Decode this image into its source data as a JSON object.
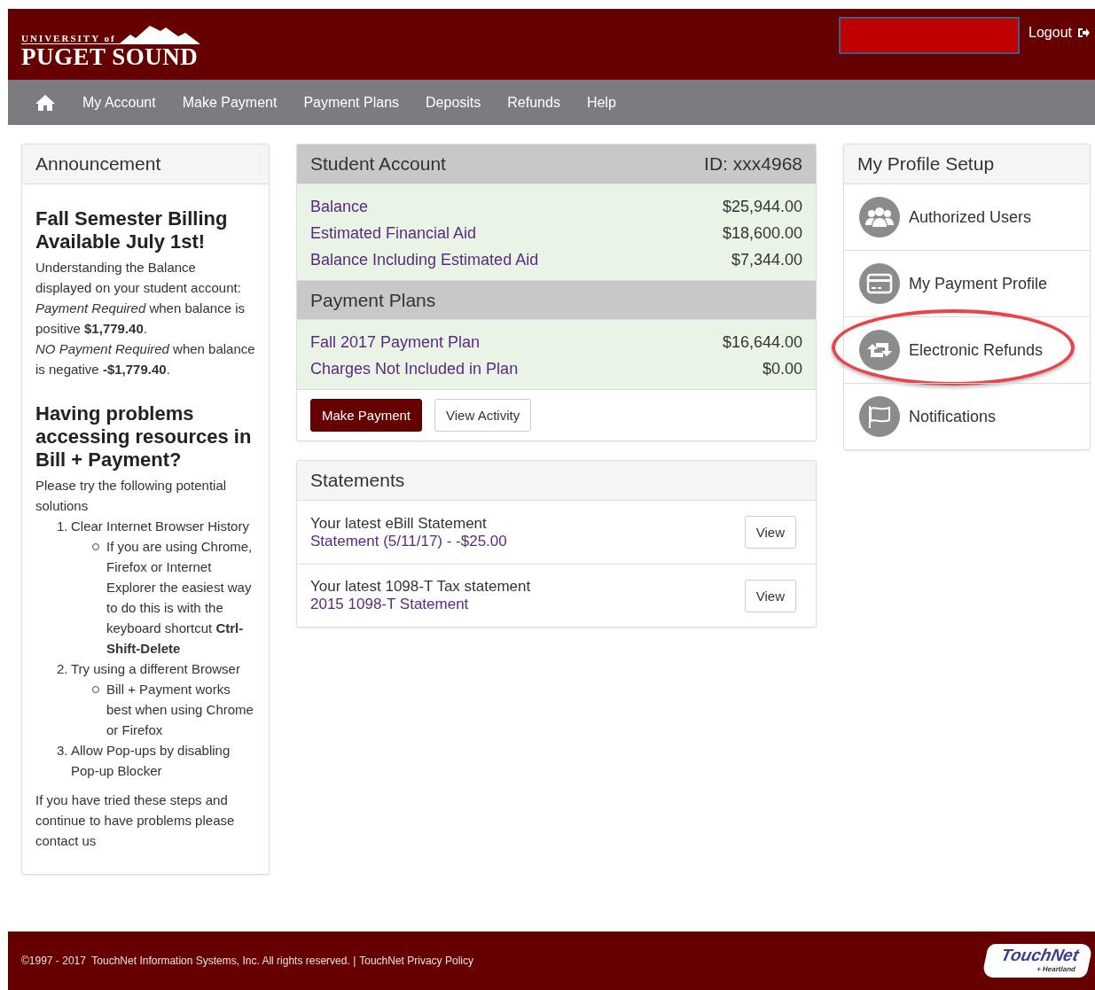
{
  "header": {
    "logo_top": "UNIVERSITY of",
    "logo_main": "PUGET SOUND",
    "logout": "Logout"
  },
  "nav": {
    "items": [
      "My Account",
      "Make Payment",
      "Payment Plans",
      "Deposits",
      "Refunds",
      "Help"
    ]
  },
  "announcement": {
    "title": "Announcement",
    "blocks": [
      {
        "kind": "heading",
        "text": "Fall Semester Billing Available July 1st!"
      },
      {
        "kind": "lines",
        "lines": [
          "Understanding the Balance displayed on your student account: *Payment Required* when balance is positive **$1,779.40**.",
          "*NO Payment Required* when balance is negative **-$1,779.40**."
        ]
      },
      {
        "kind": "heading",
        "text": "Having problems accessing resources in Bill + Payment?"
      },
      {
        "kind": "lines",
        "lines": [
          "Please try the following potential solutions"
        ]
      },
      {
        "kind": "list",
        "items": [
          {
            "number": "1.",
            "text": "Clear Internet Browser History",
            "children": [
              {
                "text": "If you are using Chrome, Firefox or Internet Explorer the easiest way to do this is with the keyboard shortcut **Ctrl-Shift-Delete**"
              }
            ]
          },
          {
            "number": "2.",
            "text": "Try using a different Browser",
            "children": [
              {
                "text": "Bill + Payment works best when using Chrome or Firefox"
              }
            ]
          },
          {
            "number": "3.",
            "text": "Allow Pop-ups by disabling Pop-up Blocker"
          }
        ]
      },
      {
        "kind": "lines",
        "lines": [
          "If you have tried these steps and continue to have problems please contact us"
        ]
      }
    ]
  },
  "student_account": {
    "title": "Student Account",
    "id": "ID: xxx4968",
    "rows": [
      {
        "label": "Balance",
        "value": "$25,944.00"
      },
      {
        "label": "Estimated Financial Aid",
        "value": "$18,600.00"
      },
      {
        "label": "Balance Including Estimated Aid",
        "value": "$7,344.00"
      }
    ],
    "plans_title": "Payment Plans",
    "plan_rows": [
      {
        "label": "Fall 2017 Payment Plan",
        "value": "$16,644.00"
      },
      {
        "label": "Charges Not Included in Plan",
        "value": "$0.00"
      }
    ],
    "buttons": [
      {
        "label": "Make Payment",
        "kind": "primary"
      },
      {
        "label": "View Activity",
        "kind": "default"
      }
    ]
  },
  "statements": {
    "title": "Statements",
    "rows": [
      {
        "caption": "Your latest eBill Statement",
        "link": "Statement (5/11/17) - -$25.00",
        "button": "View"
      },
      {
        "caption": "Your latest 1098-T Tax statement",
        "link": "2015 1098-T Statement",
        "button": "View"
      }
    ]
  },
  "profile": {
    "title": "My Profile Setup",
    "items": [
      {
        "label": "Authorized Users",
        "highlighted": false
      },
      {
        "label": "My Payment Profile",
        "highlighted": false
      },
      {
        "label": "Electronic Refunds",
        "highlighted": true
      },
      {
        "label": "Notifications",
        "highlighted": false
      }
    ]
  },
  "footer": {
    "copyright": "©1997 - 2017  TouchNet Information Systems, Inc. All rights reserved. |",
    "privacy": "TouchNet Privacy Policy",
    "logo_main": "TouchNet",
    "logo_sub": "+ Heartland"
  }
}
